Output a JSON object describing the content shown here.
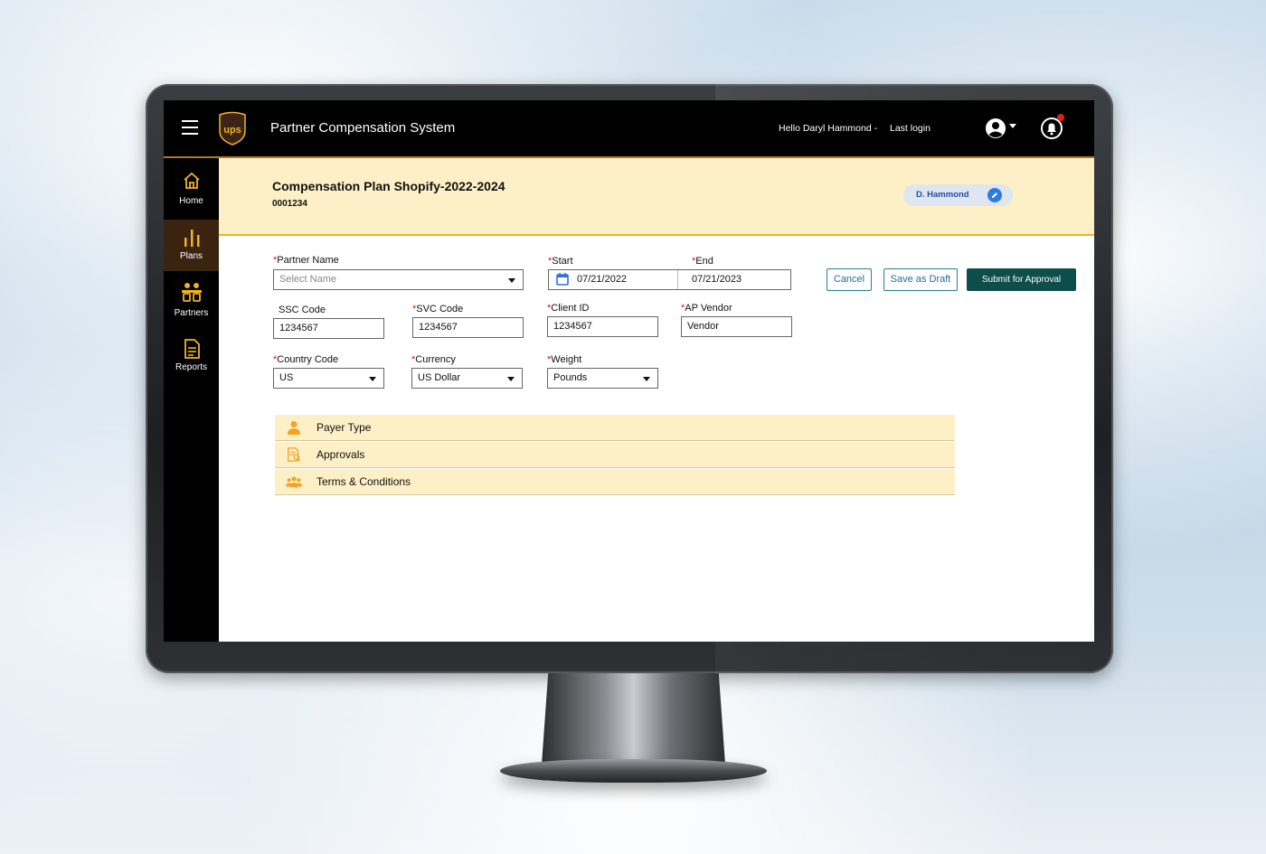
{
  "app": {
    "title": "Partner Compensation System",
    "logo_text": "ups",
    "greeting": "Hello Daryl Hammond -",
    "last_login": "Last login"
  },
  "sidebar": {
    "items": [
      {
        "label": "Home",
        "icon": "home-icon"
      },
      {
        "label": "Plans",
        "icon": "bar-chart-icon",
        "active": true
      },
      {
        "label": "Partners",
        "icon": "partners-icon"
      },
      {
        "label": "Reports",
        "icon": "document-icon"
      }
    ]
  },
  "plan": {
    "title": "Compensation Plan Shopify-2022-2024",
    "id": "0001234",
    "owner": "D. Hammond"
  },
  "form": {
    "partner_name": {
      "label": "Partner Name",
      "placeholder": "Select Name",
      "required": true
    },
    "start": {
      "label": "Start",
      "value": "07/21/2022",
      "required": true
    },
    "end": {
      "label": "End",
      "value": "07/21/2023",
      "required": true
    },
    "ssc_code": {
      "label": "SSC Code",
      "value": "1234567"
    },
    "svc_code": {
      "label": "SVC Code",
      "value": "1234567",
      "required": true
    },
    "client_id": {
      "label": "Client ID",
      "value": "1234567",
      "required": true
    },
    "ap_vendor": {
      "label": "AP Vendor",
      "value": "Vendor",
      "required": true
    },
    "country_code": {
      "label": "Country Code",
      "value": "US",
      "required": true
    },
    "currency": {
      "label": "Currency",
      "value": "US Dollar",
      "required": true
    },
    "weight": {
      "label": "Weight",
      "value": "Pounds",
      "required": true
    }
  },
  "actions": {
    "cancel": "Cancel",
    "save_draft": "Save as Draft",
    "submit": "Submit for Approval"
  },
  "sections": [
    {
      "label": "Payer Type",
      "icon": "person-icon"
    },
    {
      "label": "Approvals",
      "icon": "approval-document-icon"
    },
    {
      "label": "Terms & Conditions",
      "icon": "group-icon"
    }
  ],
  "colors": {
    "accent": "#f1b325",
    "band": "#fdf0c6",
    "primary_button": "#0d4d4a",
    "topbar": "#000000"
  }
}
